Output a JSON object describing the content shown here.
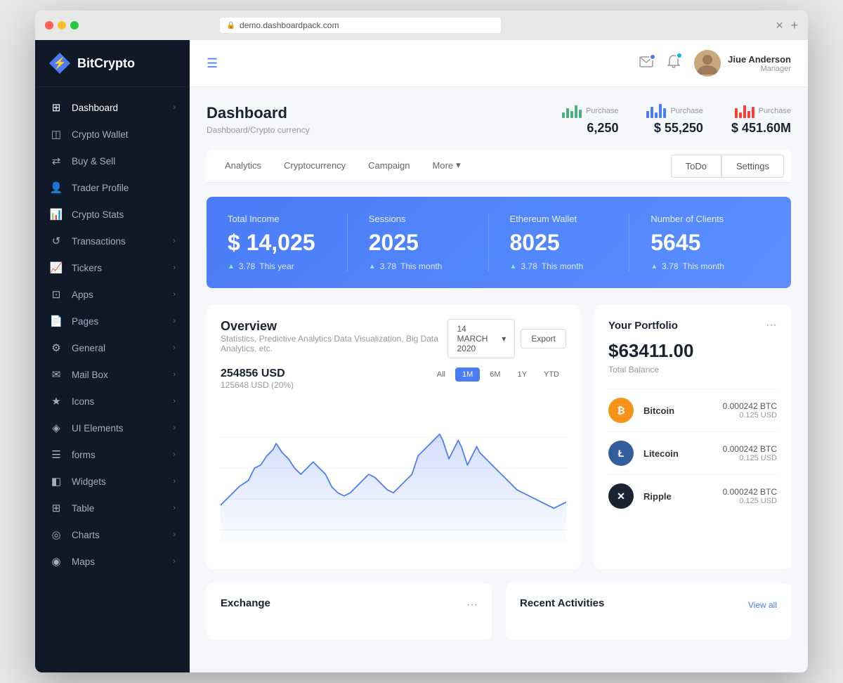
{
  "browser": {
    "url": "demo.dashboardpack.com",
    "new_tab": "+"
  },
  "sidebar": {
    "logo": "BitCrypto",
    "items": [
      {
        "id": "dashboard",
        "label": "Dashboard",
        "icon": "⊞",
        "hasArrow": true,
        "active": true
      },
      {
        "id": "crypto-wallet",
        "label": "Crypto Wallet",
        "icon": "◫",
        "hasArrow": false,
        "active": false
      },
      {
        "id": "buy-sell",
        "label": "Buy & Sell",
        "icon": "⇄",
        "hasArrow": false,
        "active": false
      },
      {
        "id": "trader-profile",
        "label": "Trader Profile",
        "icon": "👤",
        "hasArrow": false,
        "active": false
      },
      {
        "id": "crypto-stats",
        "label": "Crypto Stats",
        "icon": "📊",
        "hasArrow": false,
        "active": false
      },
      {
        "id": "transactions",
        "label": "Transactions",
        "icon": "↺",
        "hasArrow": true,
        "active": false
      },
      {
        "id": "tickers",
        "label": "Tickers",
        "icon": "📈",
        "hasArrow": true,
        "active": false
      },
      {
        "id": "apps",
        "label": "Apps",
        "icon": "⊡",
        "hasArrow": true,
        "active": false
      },
      {
        "id": "pages",
        "label": "Pages",
        "icon": "📄",
        "hasArrow": true,
        "active": false
      },
      {
        "id": "general",
        "label": "General",
        "icon": "⚙",
        "hasArrow": true,
        "active": false
      },
      {
        "id": "mailbox",
        "label": "Mail Box",
        "icon": "✉",
        "hasArrow": true,
        "active": false
      },
      {
        "id": "icons",
        "label": "Icons",
        "icon": "★",
        "hasArrow": true,
        "active": false
      },
      {
        "id": "ui-elements",
        "label": "UI Elements",
        "icon": "◈",
        "hasArrow": true,
        "active": false
      },
      {
        "id": "forms",
        "label": "forms",
        "icon": "☰",
        "hasArrow": true,
        "active": false
      },
      {
        "id": "widgets",
        "label": "Widgets",
        "icon": "◧",
        "hasArrow": true,
        "active": false
      },
      {
        "id": "table",
        "label": "Table",
        "icon": "⊞",
        "hasArrow": true,
        "active": false
      },
      {
        "id": "charts",
        "label": "Charts",
        "icon": "◎",
        "hasArrow": true,
        "active": false
      },
      {
        "id": "maps",
        "label": "Maps",
        "icon": "◉",
        "hasArrow": true,
        "active": false
      }
    ]
  },
  "topbar": {
    "user": {
      "name": "Jiue Anderson",
      "role": "Manager"
    }
  },
  "page": {
    "title": "Dashboard",
    "breadcrumb": "Dashboard/Crypto currency"
  },
  "header_stats": [
    {
      "label": "Purchase",
      "value": "6,250",
      "color": "#4caf7d"
    },
    {
      "label": "Purchase",
      "value": "$ 55,250",
      "color": "#4a7cf7"
    },
    {
      "label": "Purchase",
      "value": "$ 451.60M",
      "color": "#f44336"
    }
  ],
  "tabs": {
    "items": [
      {
        "id": "analytics",
        "label": "Analytics",
        "active": false
      },
      {
        "id": "cryptocurrency",
        "label": "Cryptocurrency",
        "active": false
      },
      {
        "id": "campaign",
        "label": "Campaign",
        "active": false
      },
      {
        "id": "more",
        "label": "More",
        "active": false,
        "hasArrow": true
      }
    ],
    "buttons": [
      {
        "id": "todo",
        "label": "ToDo"
      },
      {
        "id": "settings",
        "label": "Settings"
      }
    ]
  },
  "stats_banner": {
    "items": [
      {
        "label": "Total Income",
        "value": "$ 14,025",
        "sub_val": "3.78",
        "sub_text": "This year"
      },
      {
        "label": "Sessions",
        "value": "2025",
        "sub_val": "3.78",
        "sub_text": "This month"
      },
      {
        "label": "Ethereum Wallet",
        "value": "8025",
        "sub_val": "3.78",
        "sub_text": "This month"
      },
      {
        "label": "Number of Clients",
        "value": "5645",
        "sub_val": "3.78",
        "sub_text": "This month"
      }
    ]
  },
  "overview": {
    "title": "Overview",
    "subtitle": "Statistics, Predictive Analytics Data Visualization, Big Data Analytics, etc.",
    "date": "14 MARCH 2020",
    "export_label": "Export",
    "chart": {
      "usd": "254856 USD",
      "sub": "125648 USD (20%)",
      "periods": [
        "All",
        "1M",
        "6M",
        "1Y",
        "YTD"
      ],
      "active_period": "1M"
    }
  },
  "portfolio": {
    "title": "Your Portfolio",
    "total_value": "$63411.00",
    "total_label": "Total Balance",
    "cryptos": [
      {
        "id": "btc",
        "name": "Bitcoin",
        "btc": "0.000242 BTC",
        "usd": "0.125 USD",
        "symbol": "₿"
      },
      {
        "id": "ltc",
        "name": "Litecoin",
        "btc": "0.000242 BTC",
        "usd": "0.125 USD",
        "symbol": "Ł"
      },
      {
        "id": "xrp",
        "name": "Ripple",
        "btc": "0.000242 BTC",
        "usd": "0.125 USD",
        "symbol": "✕"
      }
    ]
  },
  "bottom": {
    "exchange": {
      "title": "Exchange",
      "dots": "..."
    },
    "recent_activities": {
      "title": "Recent Activities",
      "view_all": "View all"
    }
  }
}
